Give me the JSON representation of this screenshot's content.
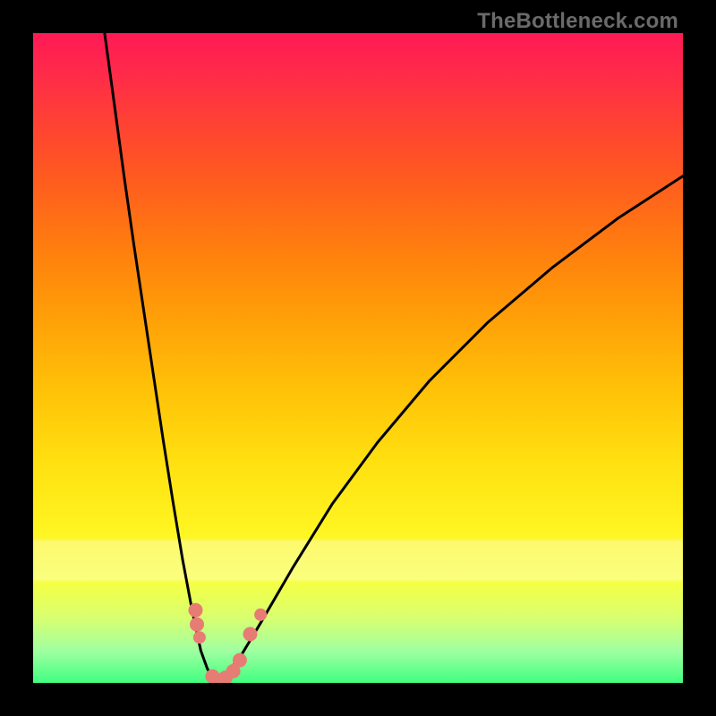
{
  "watermark": "TheBottleneck.com",
  "chart_data": {
    "type": "line",
    "title": "",
    "xlabel": "",
    "ylabel": "",
    "x_range": [
      0,
      100
    ],
    "y_range": [
      0,
      100
    ],
    "series": [
      {
        "name": "left-branch",
        "x": [
          11.0,
          12.5,
          14.0,
          15.5,
          17.0,
          18.5,
          20.0,
          21.5,
          23.0,
          24.5,
          25.8,
          26.8,
          27.5,
          28.0
        ],
        "values": [
          100.0,
          89.0,
          78.0,
          67.5,
          57.5,
          47.5,
          37.5,
          28.0,
          19.0,
          11.0,
          5.0,
          2.2,
          0.9,
          0.0
        ]
      },
      {
        "name": "right-branch",
        "x": [
          28.0,
          29.0,
          30.0,
          32.0,
          35.0,
          40.0,
          46.0,
          53.0,
          61.0,
          70.0,
          80.0,
          90.0,
          100.0
        ],
        "values": [
          0.0,
          0.6,
          1.6,
          4.2,
          9.2,
          17.8,
          27.5,
          37.0,
          46.5,
          55.5,
          64.0,
          71.5,
          78.0
        ]
      }
    ],
    "markers": {
      "name": "highlighted-points",
      "color": "#e77c74",
      "points_norm": [
        {
          "x": 0.25,
          "y": 0.112,
          "r": 8
        },
        {
          "x": 0.252,
          "y": 0.09,
          "r": 8
        },
        {
          "x": 0.256,
          "y": 0.07,
          "r": 7
        },
        {
          "x": 0.276,
          "y": 0.01,
          "r": 8
        },
        {
          "x": 0.286,
          "y": 0.005,
          "r": 7
        },
        {
          "x": 0.296,
          "y": 0.008,
          "r": 8
        },
        {
          "x": 0.308,
          "y": 0.018,
          "r": 8
        },
        {
          "x": 0.318,
          "y": 0.035,
          "r": 8
        },
        {
          "x": 0.334,
          "y": 0.075,
          "r": 8
        },
        {
          "x": 0.35,
          "y": 0.105,
          "r": 7
        }
      ]
    },
    "gradient_stops": [
      {
        "pos": 0.0,
        "color": "#ff1a55"
      },
      {
        "pos": 0.5,
        "color": "#ffd012"
      },
      {
        "pos": 0.8,
        "color": "#f8ff40"
      },
      {
        "pos": 1.0,
        "color": "#40ff80"
      }
    ]
  }
}
